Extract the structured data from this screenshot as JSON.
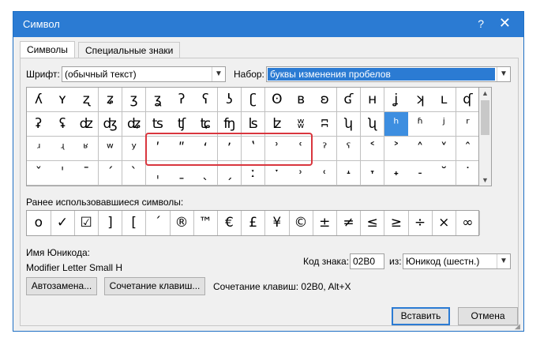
{
  "window": {
    "title": "Символ",
    "help_label": "?",
    "close_label": "✕"
  },
  "tabs": [
    "Символы",
    "Специальные знаки"
  ],
  "font_label": "Шрифт:",
  "font_value": "(обычный текст)",
  "subset_label": "Набор:",
  "subset_value": "буквы изменения пробелов",
  "symbols": [
    [
      "ʎ",
      "ʏ",
      "ʐ",
      "ʑ",
      "ʒ",
      "ʓ",
      "ʔ",
      "ʕ",
      "ʖ",
      "ʗ",
      "ʘ",
      "ʙ",
      "ʚ",
      "ʛ",
      "ʜ",
      "ʝ",
      "ʞ",
      "ʟ",
      "ʠ"
    ],
    [
      "ʡ",
      "ʢ",
      "ʣ",
      "ʤ",
      "ʥ",
      "ʦ",
      "ʧ",
      "ʨ",
      "ʩ",
      "ʪ",
      "ʫ",
      "ʬ",
      "ʭ",
      "ʮ",
      "ʯ",
      "ʰ",
      "ʱ",
      "ʲ",
      "ʳ"
    ],
    [
      "ʴ",
      "ʵ",
      "ʶ",
      "ʷ",
      "ʸ",
      "ʹ",
      "ʺ",
      "ʻ",
      "ʼ",
      "ʽ",
      "ʾ",
      "ʿ",
      "ˀ",
      "ˁ",
      "˂",
      "˃",
      "˄",
      "˅",
      "ˆ"
    ],
    [
      "ˇ",
      "ˈ",
      "ˉ",
      "ˊ",
      "ˋ",
      "ˌ",
      "ˍ",
      "ˎ",
      "ˏ",
      "ː",
      "ˑ",
      "˒",
      "˓",
      "˔",
      "˕",
      "˖",
      "˗",
      "˘",
      "˙"
    ]
  ],
  "selected_symbol": "ʰ",
  "recent_label": "Ранее использовавшиеся символы:",
  "recent": [
    "ο",
    "✓",
    "☑",
    "]",
    "[",
    "´",
    "®",
    "™",
    "€",
    "£",
    "¥",
    "©",
    "±",
    "≠",
    "≤",
    "≥",
    "÷",
    "×",
    "∞"
  ],
  "unicode_name_label": "Имя Юникода:",
  "unicode_name": "Modifier Letter Small H",
  "code_label": "Код знака:",
  "code_value": "02B0",
  "from_label": "из:",
  "from_value": "Юникод (шестн.)",
  "autocorrect_button": "Автозамена...",
  "shortcut_button": "Сочетание клавиш...",
  "shortcut_text": "Сочетание клавиш: 02B0, Alt+X",
  "insert_button": "Вставить",
  "cancel_button": "Отмена"
}
